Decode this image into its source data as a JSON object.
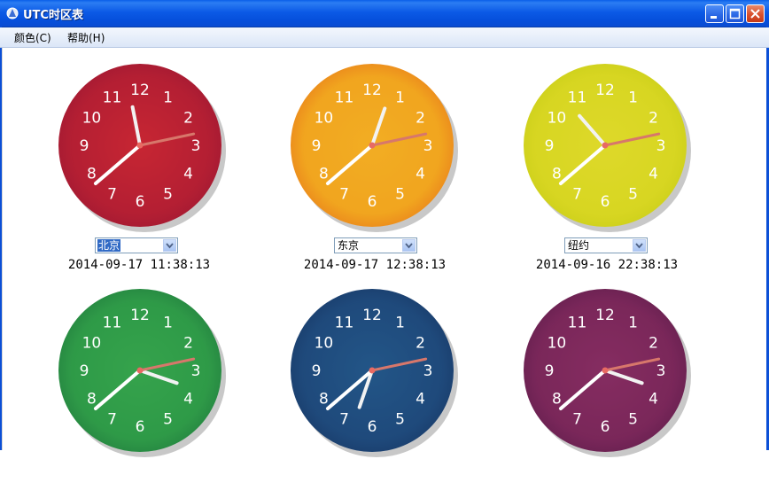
{
  "window": {
    "title": "UTC时区表",
    "icon": "app-icon",
    "controls": [
      "minimize-icon",
      "maximize-icon",
      "close-icon"
    ]
  },
  "menu": {
    "items": [
      {
        "label": "颜色(C)"
      },
      {
        "label": "帮助(H)"
      }
    ]
  },
  "clocks": [
    {
      "id": "c1",
      "face_colors": [
        "#b41f33",
        "#9c1732",
        "#d12a34"
      ],
      "hour": 11,
      "minute": 38,
      "second": 13
    },
    {
      "id": "c2",
      "face_colors": [
        "#f1a51f",
        "#e7761a",
        "#f3b126"
      ],
      "hour": 12,
      "minute": 38,
      "second": 13
    },
    {
      "id": "c3",
      "face_colors": [
        "#d8d622",
        "#c7cd17",
        "#e2da2e"
      ],
      "hour": 22,
      "minute": 38,
      "second": 13
    },
    {
      "id": "c4",
      "face_colors": [
        "#2f9a48",
        "#1f7a3c",
        "#3aa84f"
      ],
      "hour": 3,
      "minute": 38,
      "second": 13
    },
    {
      "id": "c5",
      "face_colors": [
        "#1f4a7c",
        "#173764",
        "#255c8e"
      ],
      "hour": 6,
      "minute": 38,
      "second": 13
    },
    {
      "id": "c6",
      "face_colors": [
        "#7a275a",
        "#5f1d4b",
        "#8b2f66"
      ],
      "hour": 3,
      "minute": 38,
      "second": 13
    }
  ],
  "timezones": [
    {
      "selected": "北京",
      "datetime": "2014-09-17 11:38:13"
    },
    {
      "selected": "东京",
      "datetime": "2014-09-17 12:38:13"
    },
    {
      "selected": "纽约",
      "datetime": "2014-09-16 22:38:13"
    }
  ],
  "dial_numbers": [
    "12",
    "1",
    "2",
    "3",
    "4",
    "5",
    "6",
    "7",
    "8",
    "9",
    "10",
    "11"
  ]
}
